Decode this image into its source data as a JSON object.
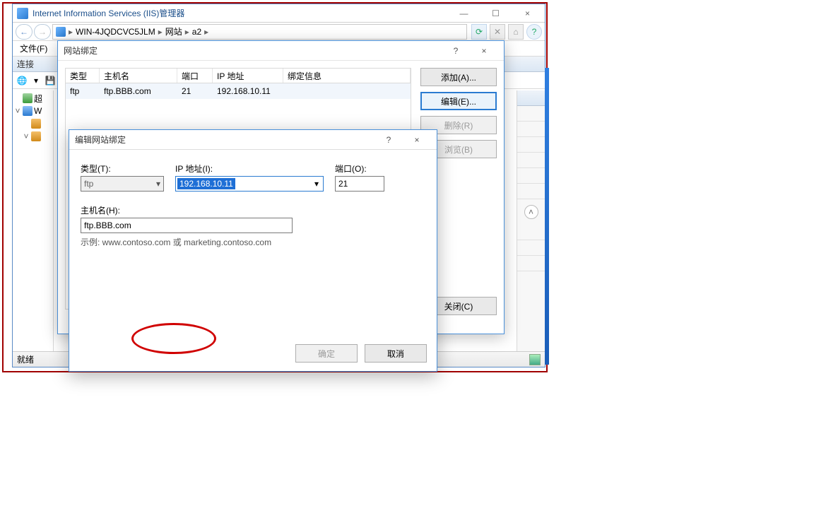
{
  "window": {
    "title": "Internet Information Services (IIS)管理器",
    "breadcrumb": {
      "server": "WIN-4JQDCVC5JLM",
      "sites": "网站",
      "site": "a2"
    },
    "menu": {
      "file": "文件(F)"
    },
    "panels": {
      "connect": "连接",
      "ready": "就绪"
    },
    "tree": {
      "node_prefix": "超",
      "server_short": "W"
    }
  },
  "bindings_dialog": {
    "title": "网站绑定",
    "columns": {
      "type": "类型",
      "host": "主机名",
      "port": "端口",
      "ip": "IP 地址",
      "info": "绑定信息"
    },
    "rows": [
      {
        "type": "ftp",
        "host": "ftp.BBB.com",
        "port": "21",
        "ip": "192.168.10.11",
        "info": ""
      }
    ],
    "buttons": {
      "add": "添加(A)...",
      "edit": "编辑(E)...",
      "remove": "删除(R)",
      "browse": "浏览(B)",
      "close": "关闭(C)"
    }
  },
  "edit_dialog": {
    "title": "编辑网站绑定",
    "labels": {
      "type": "类型(T):",
      "ip": "IP 地址(I):",
      "port": "端口(O):",
      "host": "主机名(H):"
    },
    "values": {
      "type": "ftp",
      "ip": "192.168.10.11",
      "port": "21",
      "host": "ftp.BBB.com"
    },
    "example": "示例: www.contoso.com 或 marketing.contoso.com",
    "buttons": {
      "ok": "确定",
      "cancel": "取消"
    }
  },
  "glyphs": {
    "help": "?",
    "close": "×",
    "min": "—",
    "max": "☐",
    "back": "←",
    "fwd": "→",
    "sep": "▸",
    "caret": "▾",
    "up": "˄",
    "refresh": "⟳"
  }
}
